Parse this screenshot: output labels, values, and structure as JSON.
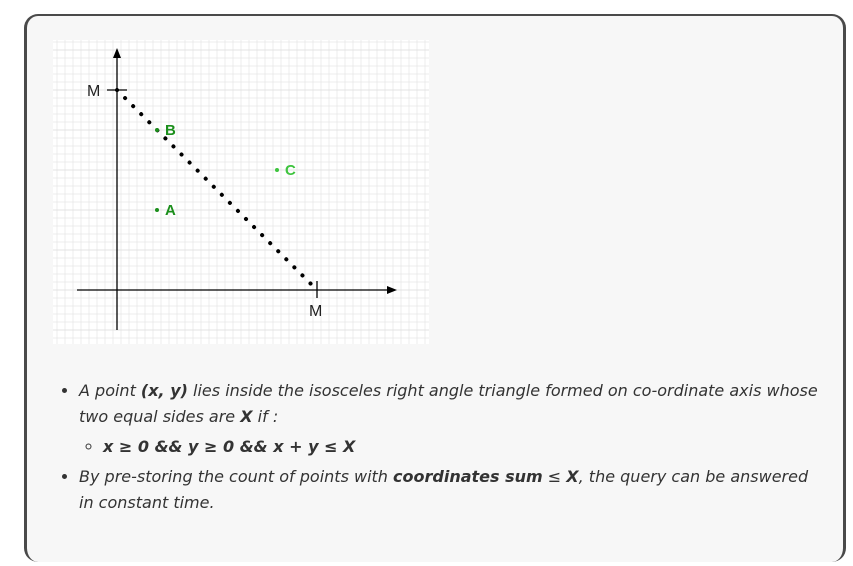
{
  "diagram": {
    "y_axis_label": "M",
    "x_axis_label": "M",
    "points": [
      {
        "label": "B",
        "x": 1,
        "y": 4,
        "color": "#1c8f1c"
      },
      {
        "label": "C",
        "x": 4,
        "y": 3,
        "color": "#3ec43e"
      },
      {
        "label": "A",
        "x": 1,
        "y": 2,
        "color": "#1c8f1c"
      }
    ],
    "hypotenuse_color": "#000000",
    "grid_color": "#e6e6e6"
  },
  "notes": {
    "b1_pre": "A point ",
    "b1_bold": "(x, y)",
    "b1_mid": " lies inside the isosceles right angle triangle formed on co-ordinate axis whose two equal sides are ",
    "b1_X": "X",
    "b1_post": " if :",
    "sub1": "x ≥ 0 && y ≥ 0 && x + y ≤ X",
    "b2_pre": "By pre-storing the count of points with ",
    "b2_bold": "coordinates sum",
    "b2_leq": " ≤ ",
    "b2_X": "X",
    "b2_post": ", the query can be answered in constant time."
  }
}
